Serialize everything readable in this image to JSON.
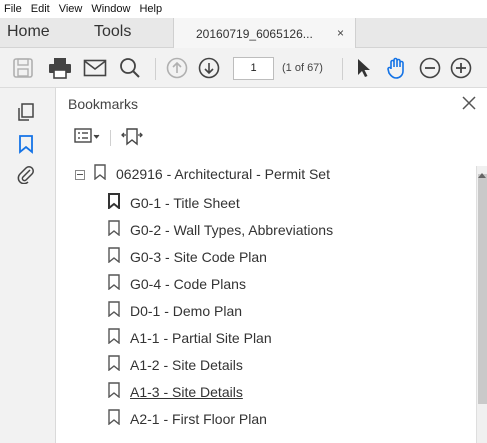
{
  "menu": {
    "items": [
      "File",
      "Edit",
      "View",
      "Window",
      "Help"
    ]
  },
  "tabs": {
    "home": "Home",
    "tools": "Tools",
    "document": "20160719_6065126...",
    "close": "×"
  },
  "toolbar": {
    "page_number": "1",
    "page_count": "(1 of 67)"
  },
  "bookmarks_panel": {
    "title": "Bookmarks",
    "root": "062916 - Architectural - Permit Set",
    "items": [
      {
        "label": "G0-1 - Title Sheet"
      },
      {
        "label": "G0-2 - Wall Types, Abbreviations"
      },
      {
        "label": "G0-3 - Site Code Plan"
      },
      {
        "label": "G0-4 - Code Plans"
      },
      {
        "label": "D0-1 - Demo Plan"
      },
      {
        "label": "A1-1 - Partial Site Plan"
      },
      {
        "label": "A1-2 - Site Details"
      },
      {
        "label": "A1-3 - Site Details"
      },
      {
        "label": "A2-1 - First Floor Plan"
      }
    ]
  },
  "colors": {
    "accent": "#1473e6",
    "icon": "#555555",
    "tab_bar": "#e8e8e8"
  },
  "icons": {
    "toolbar": [
      "save-icon",
      "print-icon",
      "email-icon",
      "search-icon",
      "prev-page-icon",
      "next-page-icon",
      "select-cursor-icon",
      "hand-tool-icon",
      "zoom-out-icon",
      "zoom-in-icon"
    ],
    "sidebar": [
      "pages-icon",
      "bookmark-icon",
      "attachment-icon"
    ]
  }
}
